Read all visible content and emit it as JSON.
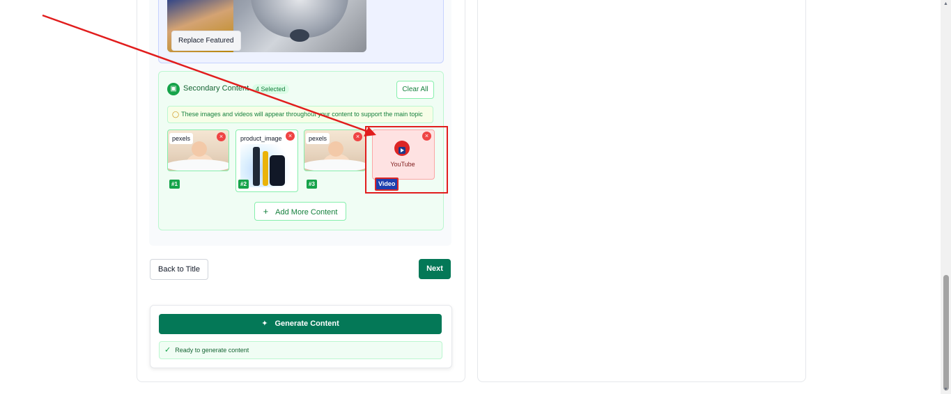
{
  "featured": {
    "replace_label": "Replace Featured"
  },
  "secondary": {
    "title": "Secondary Content",
    "badge": "4 Selected",
    "clear_label": "Clear All",
    "hint": "These images and videos will appear throughout your content to support the main topic",
    "items": [
      {
        "label": "pexels",
        "index": "#1"
      },
      {
        "label": "product_image",
        "index": "#2"
      },
      {
        "label": "pexels",
        "index": "#3"
      },
      {
        "label": "YouTube",
        "badge": "Video"
      }
    ],
    "add_more_label": "Add More Content"
  },
  "nav": {
    "back_label": "Back to Title",
    "next_label": "Next"
  },
  "generate": {
    "button_label": "Generate Content",
    "status": "Ready to generate content"
  },
  "colors": {
    "primary": "#047857",
    "accent_green": "#16a34a",
    "highlight_red": "#e11d1d",
    "video_blue": "#1e40af"
  },
  "icons": {
    "section": "image-icon",
    "hint": "lightbulb-icon",
    "remove": "close-icon",
    "add": "plus-icon",
    "generate": "sparkles-icon",
    "status": "check-circle-icon",
    "video": "youtube-icon"
  }
}
